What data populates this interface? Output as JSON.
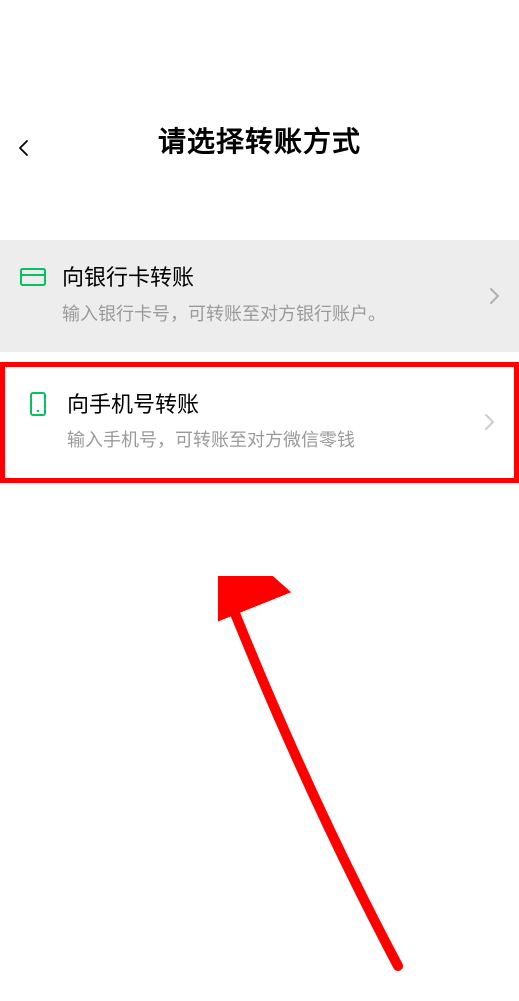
{
  "header": {
    "title": "请选择转账方式"
  },
  "options": {
    "bankCard": {
      "title": "向银行卡转账",
      "desc": "输入银行卡号，可转账至对方银行账户。"
    },
    "phoneNumber": {
      "title": "向手机号转账",
      "desc": "输入手机号，可转账至对方微信零钱"
    }
  },
  "colors": {
    "accent": "#07c160",
    "highlight": "#ff0000"
  }
}
